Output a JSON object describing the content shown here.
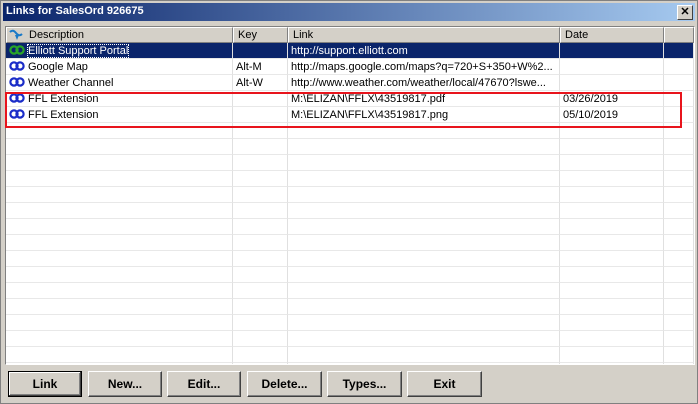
{
  "window": {
    "title": "Links for SalesOrd 926675",
    "close_glyph": "✕"
  },
  "columns": [
    {
      "label": "Description"
    },
    {
      "label": "Key"
    },
    {
      "label": "Link"
    },
    {
      "label": "Date"
    }
  ],
  "rows": [
    {
      "description": "Elliott Support Portal",
      "key": "",
      "link": "http://support.elliott.com",
      "date": "",
      "selected": true,
      "icon": "link-chain-icon"
    },
    {
      "description": "Google Map",
      "key": "Alt-M",
      "link": "http://maps.google.com/maps?q=720+S+350+W%2...",
      "date": "",
      "selected": false,
      "icon": "link-chain-icon"
    },
    {
      "description": "Weather Channel",
      "key": "Alt-W",
      "link": "http://www.weather.com/weather/local/47670?lswe...",
      "date": "",
      "selected": false,
      "icon": "link-chain-icon"
    },
    {
      "description": "FFL Extension",
      "key": "",
      "link": "M:\\ELIZAN\\FFLX\\43519817.pdf",
      "date": "03/26/2019",
      "selected": false,
      "icon": "link-chain-icon"
    },
    {
      "description": "FFL Extension",
      "key": "",
      "link": "M:\\ELIZAN\\FFLX\\43519817.png",
      "date": "05/10/2019",
      "selected": false,
      "icon": "link-chain-icon"
    }
  ],
  "buttons": {
    "link": "Link",
    "new": "New...",
    "edit": "Edit...",
    "delete": "Delete...",
    "types": "Types...",
    "exit": "Exit"
  },
  "colors": {
    "selection": "#0a246a",
    "highlight_box": "#e8141c",
    "icon_blue": "#1a2cc8"
  }
}
